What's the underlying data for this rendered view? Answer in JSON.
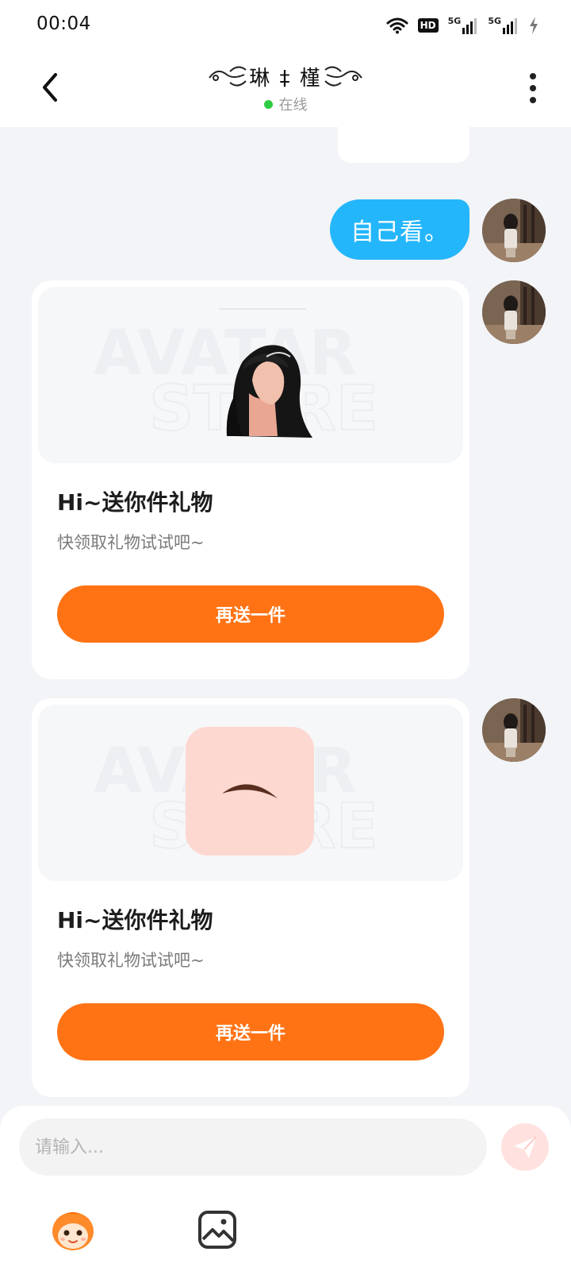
{
  "status_bar": {
    "time": "00:04",
    "hd_badge": "HD",
    "network_1": "5G",
    "network_2": "5G"
  },
  "header": {
    "contact_name": "琳 ‡ 槿",
    "presence": "在线",
    "presence_color": "#2ECC40"
  },
  "messages": {
    "sent_text": "自己看。",
    "gift_cards": [
      {
        "title": "Hi~送你件礼物",
        "subtitle": "快领取礼物试试吧~",
        "button_label": "再送一件",
        "item": "hair"
      },
      {
        "title": "Hi~送你件礼物",
        "subtitle": "快领取礼物试试吧~",
        "button_label": "再送一件",
        "item": "eyebrow"
      }
    ],
    "watermark_line1": "AVATAR",
    "watermark_line2": "STORE"
  },
  "input": {
    "placeholder": "请输入..."
  },
  "toolbar": {
    "items": [
      "avatar-mascot-icon",
      "image-icon"
    ]
  },
  "colors": {
    "accent_orange": "#FF7315",
    "bubble_blue": "#24B6FB",
    "send_bg": "#FFE2DF"
  }
}
